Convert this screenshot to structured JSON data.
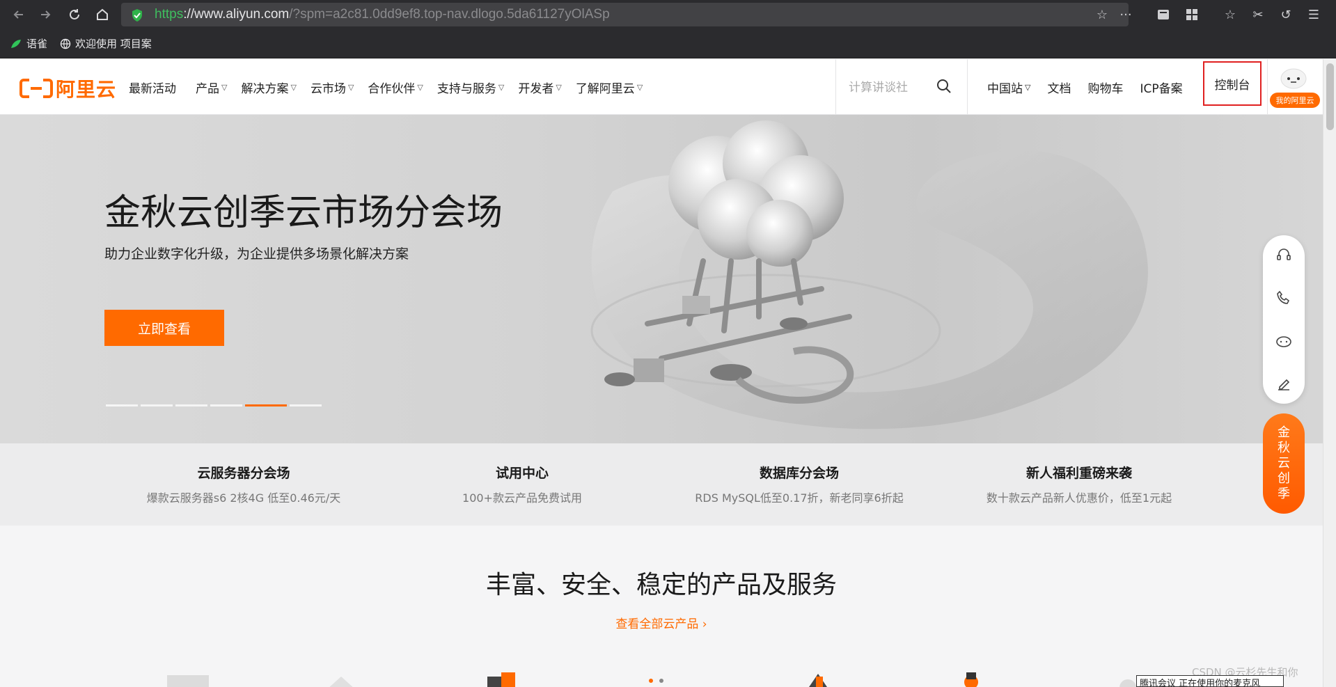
{
  "browser": {
    "url_scheme": "https",
    "url_host": "://www.aliyun.com",
    "url_rest": "/?spm=a2c81.0dd9ef8.top-nav.dlogo.5da61127yOlASp",
    "bookmarks": [
      "语雀",
      "欢迎使用 项目案"
    ]
  },
  "header": {
    "logo_text": "阿里云",
    "nav": [
      "最新活动",
      "产品",
      "解决方案",
      "云市场",
      "合作伙伴",
      "支持与服务",
      "开发者",
      "了解阿里云"
    ],
    "search_placeholder": "计算讲谈社",
    "right_nav": [
      "中国站",
      "文档",
      "购物车",
      "ICP备案"
    ],
    "console": "控制台",
    "my_aliyun": "我的阿里云"
  },
  "hero": {
    "title": "金秋云创季云市场分会场",
    "subtitle": "助力企业数字化升级，为企业提供多场景化解决方案",
    "cta": "立即查看",
    "slide_count": 6,
    "active_slide": 5
  },
  "promo": [
    {
      "title": "云服务器分会场",
      "desc": "爆款云服务器s6 2核4G 低至0.46元/天"
    },
    {
      "title": "试用中心",
      "desc": "100+款云产品免费试用"
    },
    {
      "title": "数据库分会场",
      "desc": "RDS MySQL低至0.17折，新老同享6折起"
    },
    {
      "title": "新人福利重磅来袭",
      "desc": "数十款云产品新人优惠价，低至1元起"
    }
  ],
  "products": {
    "title": "丰富、安全、稳定的产品及服务",
    "see_all": "查看全部云产品"
  },
  "float_promo": [
    "金",
    "秋",
    "云",
    "创",
    "季"
  ],
  "watermark": "CSDN @云杉先生和你",
  "toast": "腾讯会议 正在使用你的麦克风",
  "colors": {
    "accent": "#ff6a00",
    "highlight_border": "#e02020"
  }
}
